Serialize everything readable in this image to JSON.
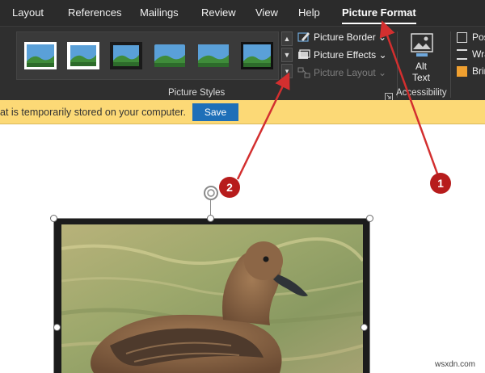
{
  "tabs": [
    {
      "label": "Layout",
      "active": false
    },
    {
      "label": "References",
      "active": false
    },
    {
      "label": "Mailings",
      "active": false
    },
    {
      "label": "Review",
      "active": false
    },
    {
      "label": "View",
      "active": false
    },
    {
      "label": "Help",
      "active": false
    },
    {
      "label": "Picture Format",
      "active": true
    }
  ],
  "ribbon": {
    "picture_styles": {
      "group_label": "Picture Styles",
      "thumbnail_count": 6
    },
    "commands": {
      "picture_border": {
        "label": "Picture Border",
        "icon": "pencil-border-icon"
      },
      "picture_effects": {
        "label": "Picture Effects",
        "icon": "effects-icon"
      },
      "picture_layout": {
        "label": "Picture Layout",
        "icon": "layout-icon",
        "disabled": true
      }
    },
    "accessibility": {
      "group_label": "Accessibility",
      "alt_text": {
        "line1": "Alt",
        "line2": "Text"
      }
    },
    "arrange": {
      "position": "Pos",
      "wrap": "Wra",
      "bring": "Brin"
    }
  },
  "message_bar": {
    "text": "at is temporarily stored on your computer.",
    "save_label": "Save"
  },
  "annotations": [
    {
      "number": "1",
      "color": "#b71c1c"
    },
    {
      "number": "2",
      "color": "#b71c1c"
    }
  ],
  "watermark": "wsxdn.com",
  "colors": {
    "ribbon_bg": "#2f2f2f",
    "tabbar_bg": "#2b2b2b",
    "message_bar": "#fcd976",
    "save_button": "#1e6fb8",
    "annotation_red": "#d32f2f"
  }
}
